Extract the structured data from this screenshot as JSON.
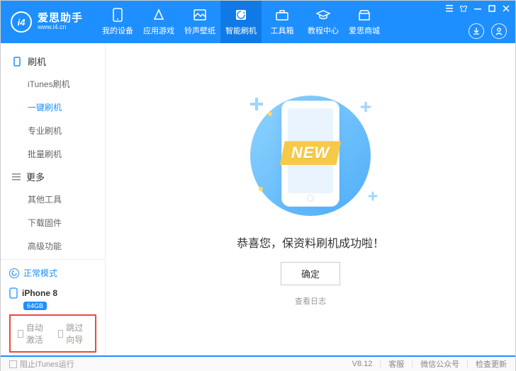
{
  "header": {
    "brand": "爱思助手",
    "url": "www.i4.cn",
    "nav": [
      {
        "label": "我的设备"
      },
      {
        "label": "应用游戏"
      },
      {
        "label": "铃声壁纸"
      },
      {
        "label": "智能刷机"
      },
      {
        "label": "工具箱"
      },
      {
        "label": "教程中心"
      },
      {
        "label": "爱思商城"
      }
    ]
  },
  "sidebar": {
    "group1": "刷机",
    "items1": [
      {
        "label": "iTunes刷机"
      },
      {
        "label": "一键刷机"
      },
      {
        "label": "专业刷机"
      },
      {
        "label": "批量刷机"
      }
    ],
    "group2": "更多",
    "items2": [
      {
        "label": "其他工具"
      },
      {
        "label": "下载固件"
      },
      {
        "label": "高级功能"
      }
    ],
    "mode": "正常模式",
    "device": "iPhone 8",
    "storage": "64GB",
    "opt1": "自动激活",
    "opt2": "跳过向导"
  },
  "main": {
    "newLabel": "NEW",
    "message": "恭喜您，保资料刷机成功啦！",
    "okBtn": "确定",
    "logLink": "查看日志"
  },
  "footer": {
    "stopItunes": "阻止iTunes运行",
    "version": "V8.12",
    "support": "客服",
    "wechat": "微信公众号",
    "update": "检查更新"
  }
}
